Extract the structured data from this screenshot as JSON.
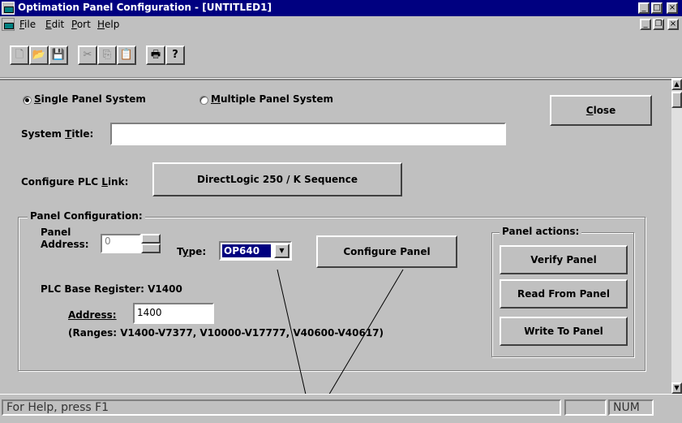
{
  "window": {
    "title": "Optimation Panel Configuration - [UNTITLED1]",
    "minimize_glyph": "_",
    "maximize_glyph": "□",
    "close_glyph": "×"
  },
  "menu": {
    "items": [
      {
        "letter": "F",
        "rest": "ile"
      },
      {
        "letter": "E",
        "rest": "dit"
      },
      {
        "letter": "P",
        "rest": "ort"
      },
      {
        "letter": "H",
        "rest": "elp"
      }
    ],
    "mdi_min_glyph": "_",
    "mdi_restore_glyph": "❐",
    "mdi_close_glyph": "×"
  },
  "toolbar": {
    "icons": [
      "new-file-icon",
      "open-folder-icon",
      "save-icon",
      "cut-icon",
      "copy-icon",
      "paste-icon",
      "print-icon",
      "help-icon"
    ],
    "glyphs": [
      "🗋",
      "📂",
      "💾",
      "✂",
      "⎘",
      "📋",
      "🖶",
      "?"
    ]
  },
  "system": {
    "single_label_u": "S",
    "single_label_rest": "ingle Panel System",
    "multiple_label_u": "M",
    "multiple_label_rest": "ultiple Panel System",
    "selected": "single",
    "close_button": "Close",
    "title_label_pre": "System ",
    "title_label_u": "T",
    "title_label_post": "itle:",
    "title_value": ""
  },
  "plc_link": {
    "label_pre": "Configure PLC ",
    "label_u": "L",
    "label_post": "ink:",
    "button": "DirectLogic 250 / K Sequence"
  },
  "panel_config": {
    "legend": "Panel Configuration:",
    "panel_label": "Panel",
    "address_label": "Address:",
    "address_value": "0",
    "type_label": "Type:",
    "type_value": "OP640",
    "configure_button": "Configure Panel",
    "plc_base_register": "PLC Base Register: V1400",
    "reg_address_label": "Address:",
    "reg_address_value": "1400",
    "ranges": "(Ranges: V1400-V7377, V10000-V17777, V40600-V40617)"
  },
  "panel_actions": {
    "legend": "Panel actions:",
    "verify": "Verify Panel",
    "read": "Read From Panel",
    "write": "Write To Panel"
  },
  "status": {
    "help_text": "For Help, press F1",
    "num": "NUM"
  },
  "scrollbar": {
    "up_glyph": "▲",
    "down_glyph": "▼"
  }
}
